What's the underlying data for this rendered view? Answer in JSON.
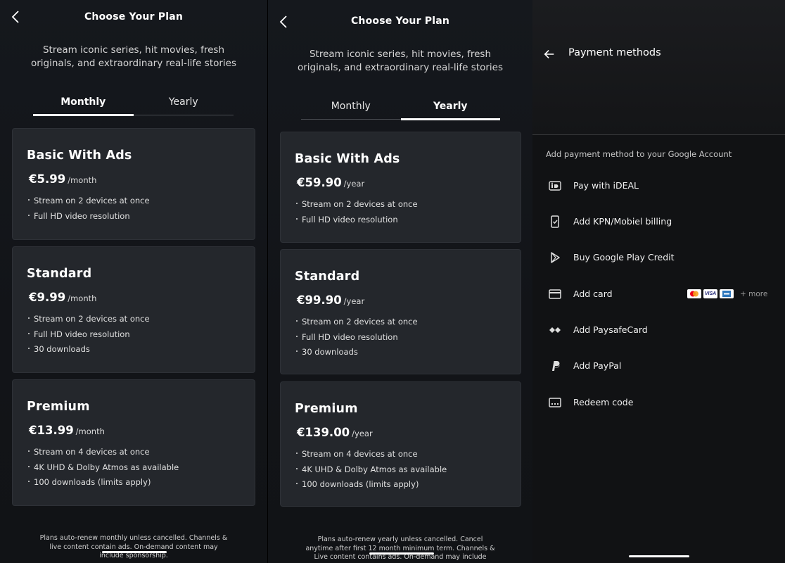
{
  "screens": [
    {
      "title": "Choose Your Plan",
      "subtitle_line1": "Stream iconic series, hit movies, fresh",
      "subtitle_line2": "originals, and extraordinary real-life stories",
      "tabs": [
        "Monthly",
        "Yearly"
      ],
      "active_tab": "Monthly",
      "plans": [
        {
          "name": "Basic With Ads",
          "price": "€5.99",
          "unit": "/month",
          "features": [
            "Stream on 2 devices at once",
            "Full HD video resolution"
          ]
        },
        {
          "name": "Standard",
          "price": "€9.99",
          "unit": "/month",
          "features": [
            "Stream on 2 devices at once",
            "Full HD video resolution",
            "30 downloads"
          ]
        },
        {
          "name": "Premium",
          "price": "€13.99",
          "unit": "/month",
          "features": [
            "Stream on 4 devices at once",
            "4K UHD & Dolby Atmos as available",
            "100 downloads (limits apply)"
          ]
        }
      ],
      "fineprint_lines": [
        "Plans auto-renew monthly unless cancelled. Channels &",
        "live content contain ads. On-demand content may",
        "include sponsorship."
      ]
    },
    {
      "title": "Choose Your Plan",
      "subtitle_line1": "Stream iconic series, hit movies, fresh",
      "subtitle_line2": "originals, and extraordinary real-life stories",
      "tabs": [
        "Monthly",
        "Yearly"
      ],
      "active_tab": "Yearly",
      "plans": [
        {
          "name": "Basic With Ads",
          "price": "€59.90",
          "unit": "/year",
          "features": [
            "Stream on 2 devices at once",
            "Full HD video resolution"
          ]
        },
        {
          "name": "Standard",
          "price": "€99.90",
          "unit": "/year",
          "features": [
            "Stream on 2 devices at once",
            "Full HD video resolution",
            "30 downloads"
          ]
        },
        {
          "name": "Premium",
          "price": "€139.00",
          "unit": "/year",
          "features": [
            "Stream on 4 devices at once",
            "4K UHD & Dolby Atmos as available",
            "100 downloads (limits apply)"
          ]
        }
      ],
      "fineprint_lines": [
        "Plans auto-renew yearly unless cancelled. Cancel",
        "anytime after first 12 month minimum term. Channels &",
        "Live content contains ads. On-demand may include"
      ]
    }
  ],
  "payment": {
    "title": "Payment methods",
    "section_label": "Add payment method to your Google Account",
    "options": [
      {
        "label": "Pay with iDEAL",
        "icon": "ideal-icon"
      },
      {
        "label": "Add KPN/Mobiel billing",
        "icon": "phone-billing-icon"
      },
      {
        "label": "Buy Google Play Credit",
        "icon": "google-play-icon"
      },
      {
        "label": "Add card",
        "icon": "credit-card-icon"
      },
      {
        "label": "Add PaysafeCard",
        "icon": "paysafecard-icon"
      },
      {
        "label": "Add PayPal",
        "icon": "paypal-icon"
      },
      {
        "label": "Redeem code",
        "icon": "redeem-code-icon"
      }
    ],
    "card_logos": [
      "mastercard",
      "visa",
      "amex"
    ],
    "card_logo_text": {
      "visa": "VISA"
    },
    "more_label": "+ more"
  },
  "colors": {
    "background": "#121418",
    "card": "#24272c",
    "payment_background": "#111214"
  }
}
